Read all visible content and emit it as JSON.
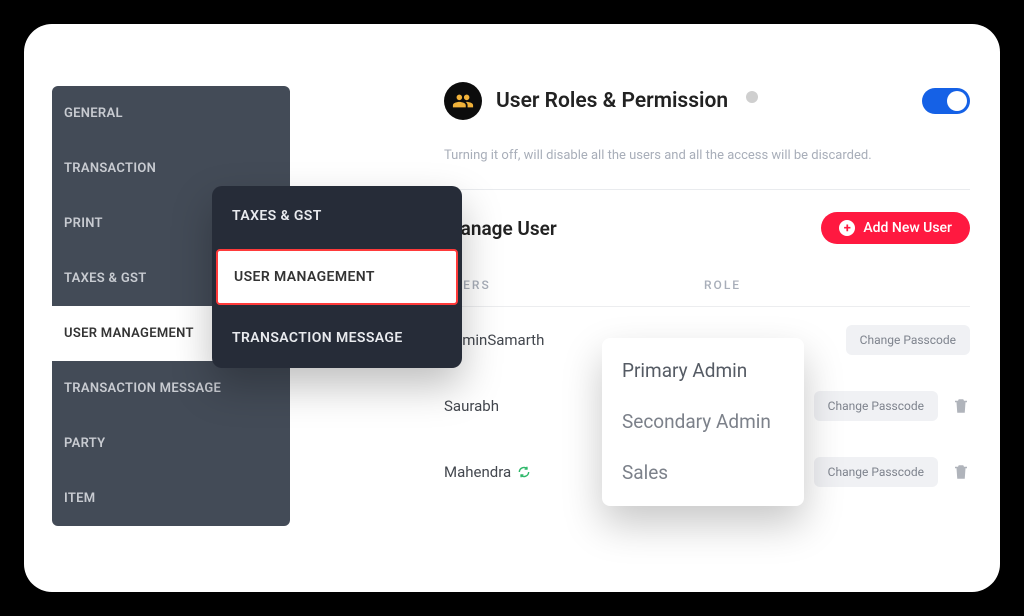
{
  "sidebar": {
    "items": [
      {
        "label": "GENERAL"
      },
      {
        "label": "TRANSACTION"
      },
      {
        "label": "PRINT"
      },
      {
        "label": "TAXES & GST"
      },
      {
        "label": "USER MANAGEMENT"
      },
      {
        "label": "TRANSACTION MESSAGE"
      },
      {
        "label": "PARTY"
      },
      {
        "label": "ITEM"
      }
    ]
  },
  "submenu": {
    "items": [
      {
        "label": "TAXES & GST"
      },
      {
        "label": "USER MANAGEMENT"
      },
      {
        "label": "TRANSACTION MESSAGE"
      }
    ]
  },
  "header": {
    "title": "User Roles & Permission",
    "note": "Turning it off, will disable all the users and all the access will be discarded."
  },
  "manage": {
    "title": "Manage User",
    "add_label": "Add New User",
    "columns": {
      "users": "USERS",
      "role": "ROLE"
    }
  },
  "users": [
    {
      "name": "AdminSamarth",
      "action": "Change Passcode",
      "deletable": false,
      "sync": false
    },
    {
      "name": "Saurabh",
      "action": "Change Passcode",
      "deletable": true,
      "sync": false
    },
    {
      "name": "Mahendra",
      "action": "Change Passcode",
      "deletable": true,
      "sync": true
    }
  ],
  "roles_dropdown": [
    "Primary Admin",
    "Secondary Admin",
    "Sales"
  ]
}
